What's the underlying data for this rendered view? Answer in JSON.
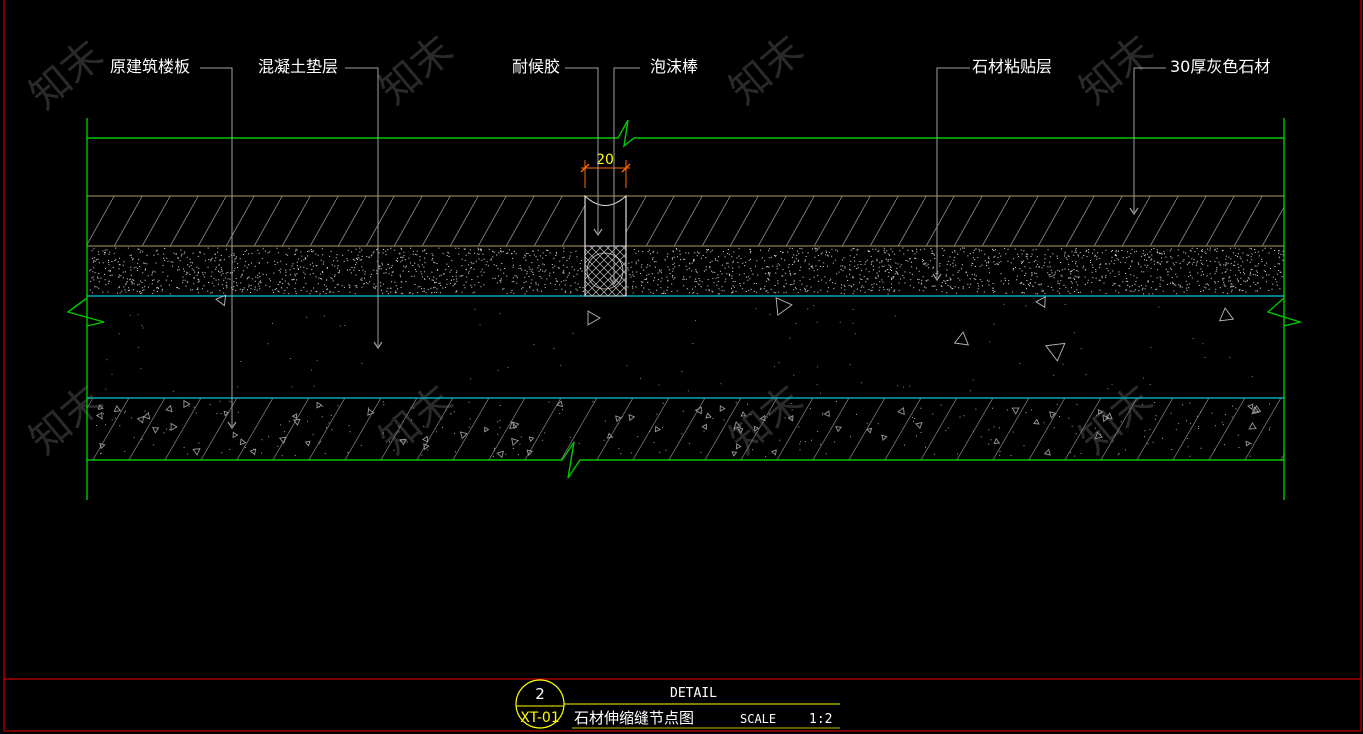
{
  "labels": {
    "original_slab": "原建筑楼板",
    "concrete_cushion": "混凝土垫层",
    "weather_sealant": "耐候胶",
    "foam_rod": "泡沫棒",
    "stone_adhesive_layer": "石材粘贴层",
    "grey_stone_30": "30厚灰色石材"
  },
  "dimension": {
    "joint_width": "20"
  },
  "title_block": {
    "detail_number": "2",
    "sheet_ref": "XT-01",
    "detail_word": "DETAIL",
    "title": "石材伸缩缝节点图",
    "scale_word": "SCALE",
    "scale_value": "1:2"
  },
  "watermark": {
    "text": "知末"
  },
  "colors": {
    "background": "#000000",
    "green_line": "#00c800",
    "cyan_line": "#00c8d8",
    "tan_line": "#b09860",
    "grey_leader": "#a0a0a0",
    "yellow": "#ffff00",
    "orange_dim": "#ff6a00",
    "red_border": "#c80000"
  }
}
